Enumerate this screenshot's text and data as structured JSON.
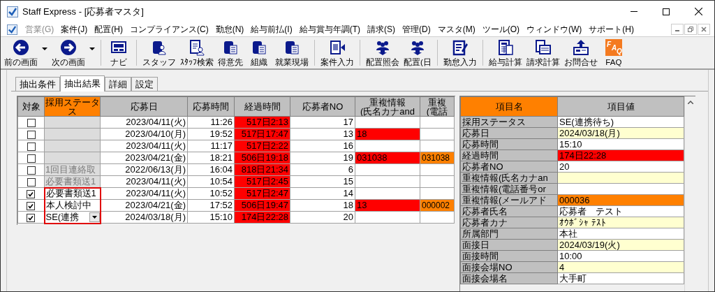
{
  "window": {
    "title": "Staff Express - [応募者マスタ]"
  },
  "menu": [
    {
      "label": "営業(G)",
      "disabled": true
    },
    {
      "label": "案件(J)",
      "disabled": false
    },
    {
      "label": "配置(H)",
      "disabled": false
    },
    {
      "label": "コンプライアンス(C)",
      "disabled": false
    },
    {
      "label": "勤怠(N)",
      "disabled": false
    },
    {
      "label": "給与前払(I)",
      "disabled": false
    },
    {
      "label": "給与賞与年調(T)",
      "disabled": false
    },
    {
      "label": "請求(S)",
      "disabled": false
    },
    {
      "label": "管理(D)",
      "disabled": false
    },
    {
      "label": "マスタ(M)",
      "disabled": false
    },
    {
      "label": "ツール(O)",
      "disabled": false
    },
    {
      "label": "ウィンドウ(W)",
      "disabled": false
    },
    {
      "label": "サポート(H)",
      "disabled": false
    }
  ],
  "toolbar": [
    {
      "label": "前の画面",
      "kind": "back",
      "dropdown": true,
      "group_end": false
    },
    {
      "label": "次の画面",
      "kind": "forward",
      "dropdown": true,
      "group_end": true
    },
    {
      "label": "ナビ",
      "kind": "navi",
      "dropdown": false,
      "group_end": true
    },
    {
      "label": "スタッフ",
      "kind": "person",
      "dropdown": false,
      "group_end": false
    },
    {
      "label": "ｽﾀｯﾌ検索",
      "kind": "document",
      "dropdown": false,
      "group_end": false
    },
    {
      "label": "得意先",
      "kind": "building",
      "dropdown": false,
      "group_end": false
    },
    {
      "label": "組織",
      "kind": "building",
      "dropdown": false,
      "group_end": false
    },
    {
      "label": "就業現場",
      "kind": "building",
      "dropdown": false,
      "group_end": true
    },
    {
      "label": "案件入力",
      "kind": "import",
      "dropdown": false,
      "group_end": true
    },
    {
      "label": "配置照会",
      "kind": "people",
      "dropdown": false,
      "group_end": false
    },
    {
      "label": "配置(日",
      "kind": "people",
      "dropdown": false,
      "group_end": true
    },
    {
      "label": "勤怠入力",
      "kind": "edit",
      "dropdown": false,
      "group_end": true
    },
    {
      "label": "給与計算",
      "kind": "calculator",
      "dropdown": false,
      "group_end": false
    },
    {
      "label": "請求計算",
      "kind": "invoice",
      "dropdown": false,
      "group_end": false
    },
    {
      "label": "お問合せ",
      "kind": "inbox",
      "dropdown": false,
      "group_end": false
    },
    {
      "label": "FAQ",
      "kind": "faq",
      "icon_letters": "FAQ",
      "dropdown": false,
      "group_end": false
    }
  ],
  "tabs": [
    {
      "label": "抽出条件",
      "selected": false
    },
    {
      "label": "抽出結果",
      "selected": true
    },
    {
      "label": "詳細",
      "selected": false
    },
    {
      "label": "設定",
      "selected": false
    }
  ],
  "grid": {
    "columns": [
      "対象",
      "採用ステータス",
      "応募日",
      "応募時間",
      "経過時間",
      "応募者NO",
      "重複情報\n(氏名カナand",
      "重複\n(電話"
    ],
    "rows": [
      {
        "checked": false,
        "disabled": true,
        "dropdown": false,
        "date": "2023/04/11(火)",
        "time": "11:26",
        "elapsed": "517日2:13",
        "no": "17",
        "highlighted": false
      },
      {
        "checked": false,
        "disabled": true,
        "dropdown": false,
        "date": "2023/04/10(月)",
        "time": "19:52",
        "elapsed": "517日17:47",
        "no": "13",
        "dup_name": "18",
        "highlighted": false
      },
      {
        "checked": false,
        "disabled": true,
        "dropdown": false,
        "date": "2023/04/11(火)",
        "time": "11:17",
        "elapsed": "517日2:22",
        "no": "16",
        "highlighted": false
      },
      {
        "checked": false,
        "disabled": true,
        "dropdown": false,
        "date": "2023/04/21(金)",
        "time": "18:21",
        "elapsed": "506日19:18",
        "no": "19",
        "dup_name": "031038",
        "dup_phone": "031038",
        "highlighted": false
      },
      {
        "checked": false,
        "status": "1回目連絡取",
        "disabled": true,
        "dropdown": false,
        "date": "2022/06/13(月)",
        "time": "16:04",
        "elapsed": "818日21:34",
        "no": "6",
        "highlighted": false
      },
      {
        "checked": false,
        "status": "必要書類送1",
        "disabled": true,
        "dropdown": false,
        "date": "2023/04/11(火)",
        "time": "10:54",
        "elapsed": "517日2:45",
        "no": "15",
        "highlighted": false
      },
      {
        "checked": true,
        "status": "必要書類送1",
        "disabled": false,
        "dropdown": false,
        "date": "2023/04/11(火)",
        "time": "10:52",
        "elapsed": "517日2:47",
        "no": "14",
        "highlighted": true
      },
      {
        "checked": true,
        "status": "本人検討中",
        "disabled": false,
        "dropdown": false,
        "date": "2023/04/21(金)",
        "time": "17:52",
        "elapsed": "506日19:47",
        "no": "18",
        "dup_name": "13",
        "dup_phone": "000002",
        "highlighted": true
      },
      {
        "checked": true,
        "status": "SE(連携",
        "disabled": false,
        "dropdown": true,
        "date": "2024/03/18(月)",
        "time": "15:10",
        "elapsed": "174日22:28",
        "no": "20",
        "highlighted": true
      }
    ]
  },
  "detail": {
    "columns": [
      "項目名",
      "項目値"
    ],
    "rows": [
      {
        "name": "採用ステータス",
        "value": "SE(連携待ち)",
        "color": "#ffffff"
      },
      {
        "name": "応募日",
        "value": "2024/03/18(月)",
        "color": "#ffffd0"
      },
      {
        "name": "応募時間",
        "value": "15:10",
        "color": "#ffffff"
      },
      {
        "name": "経過時間",
        "value": "174日22:28",
        "color": "#ff0000"
      },
      {
        "name": "応募者NO",
        "value": "20",
        "color": "#ffffff"
      },
      {
        "name": "重複情報(氏名カナan",
        "color": "#ffffd0"
      },
      {
        "name": "重複情報(電話番号or",
        "color": "#ffffff"
      },
      {
        "name": "重複情報(メールアド",
        "value": "000036",
        "color": "#ff8000"
      },
      {
        "name": "応募者氏名",
        "value": "応募者　テスト",
        "color": "#ffffff"
      },
      {
        "name": "応募者カナ",
        "value": "ｵｳﾎﾞｼｬ ﾃｽﾄ",
        "color": "#ffffd0"
      },
      {
        "name": "所属部門",
        "value": "本社",
        "color": "#ffffff"
      },
      {
        "name": "面接日",
        "value": "2024/03/19(火)",
        "color": "#ffffd0"
      },
      {
        "name": "面接時間",
        "value": "10:00",
        "color": "#ffffff"
      },
      {
        "name": "面接会場NO",
        "value": "4",
        "color": "#ffffd0"
      },
      {
        "name": "面接会場名",
        "value": "大手町",
        "color": "#ffffff"
      }
    ]
  }
}
